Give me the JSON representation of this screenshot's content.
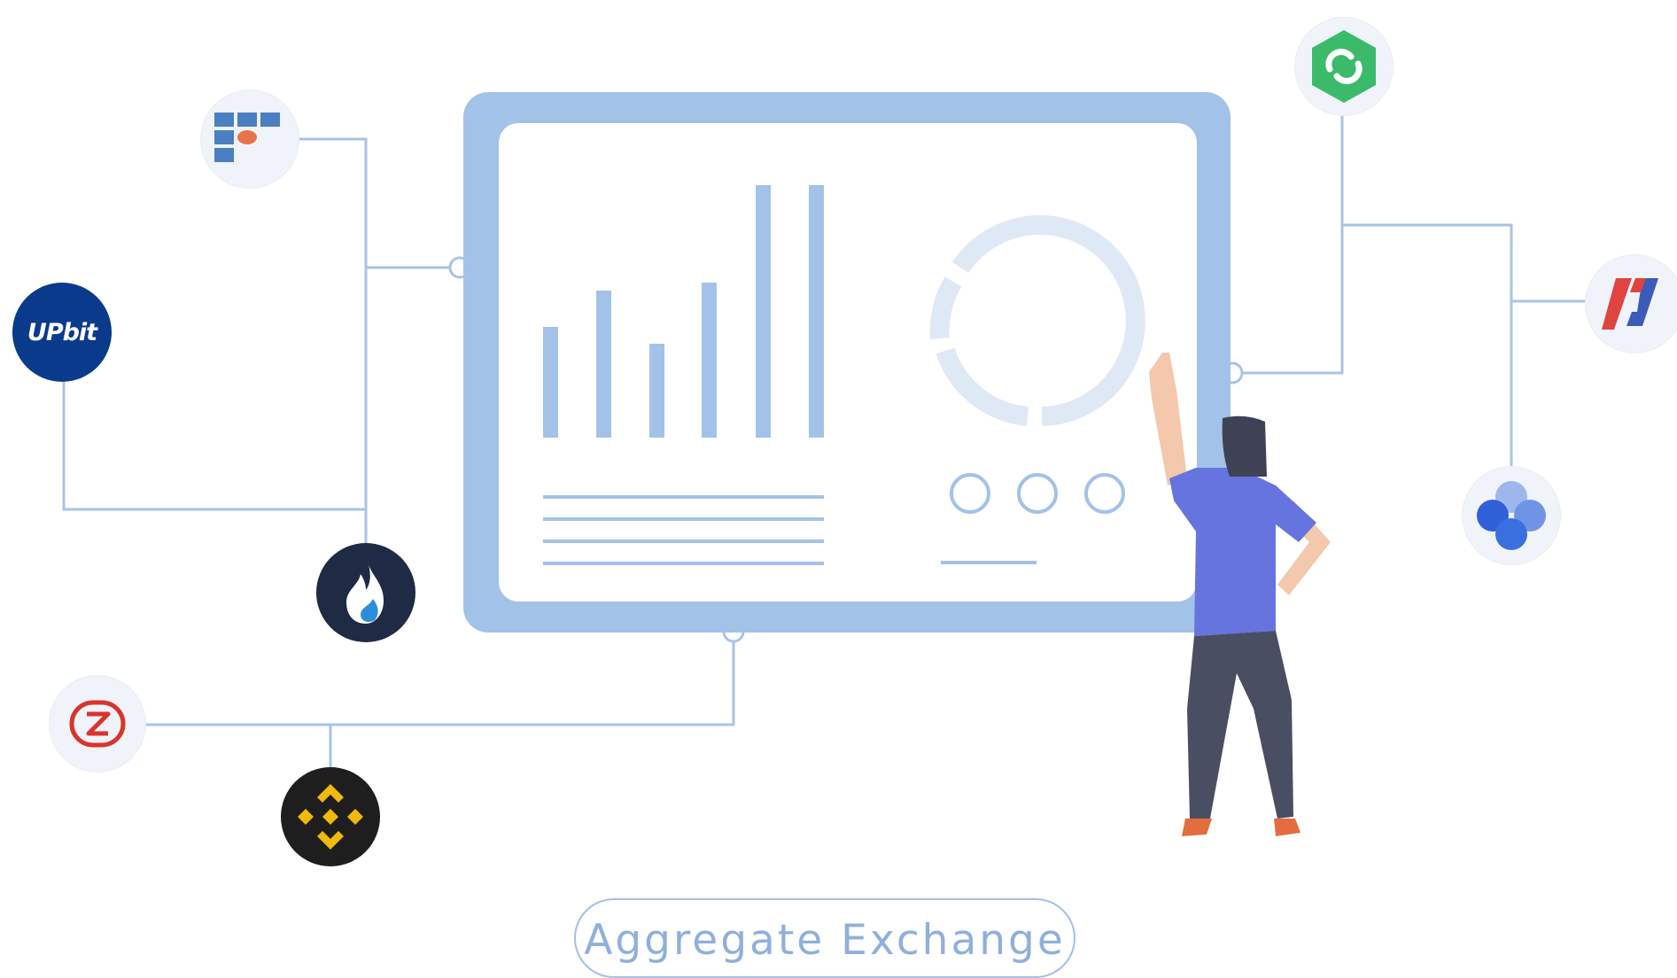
{
  "hero": {
    "cta_label": "Aggregate Exchange"
  },
  "exchange_logos": [
    {
      "name": "upbit",
      "text": "UPbit",
      "color": "#0a3a8c"
    },
    {
      "name": "ftx",
      "colors": [
        "#4a7fc1",
        "#e8734a"
      ]
    },
    {
      "name": "huobi",
      "colors": [
        "#1f2a44",
        "#2b8cdb"
      ]
    },
    {
      "name": "zb",
      "color": "#d9342b"
    },
    {
      "name": "binance",
      "colors": [
        "#1e1e1e",
        "#f0b90b"
      ]
    },
    {
      "name": "kucoin",
      "color": "#3bbb6a"
    },
    {
      "name": "bitmex",
      "colors": [
        "#e0443e",
        "#3b5bb8"
      ]
    },
    {
      "name": "okex",
      "color": "#3a6fe0"
    }
  ],
  "colors": {
    "accent": "#a3c2e8",
    "line": "#a9c3e6",
    "screen_bg": "#ffffff",
    "person_shirt": "#6674e0",
    "person_pants": "#4a4e63"
  }
}
